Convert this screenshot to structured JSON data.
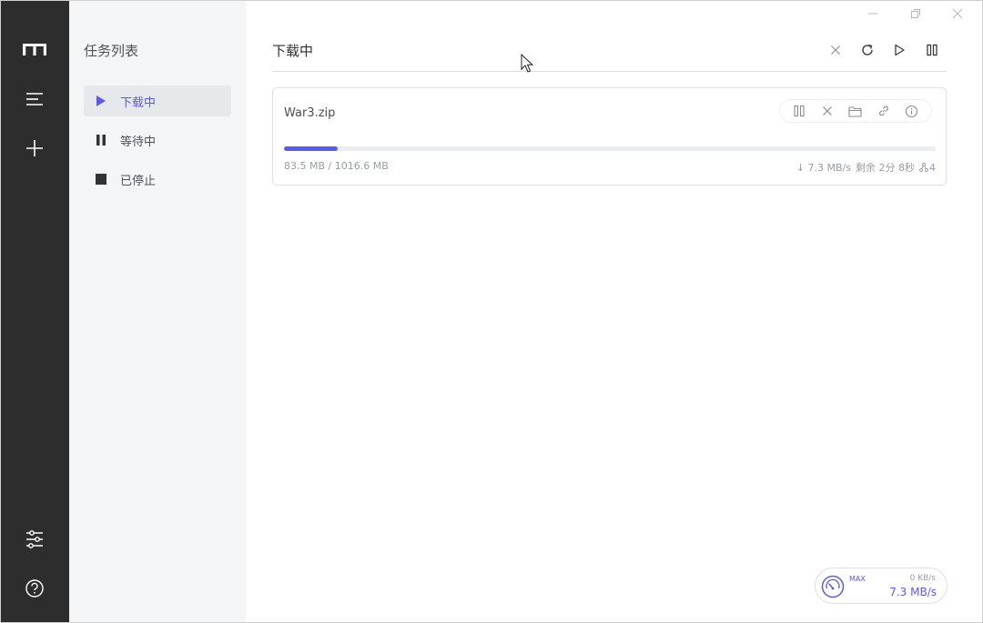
{
  "colors": {
    "accent": "#5b5bea",
    "nav_bg": "#2d2d2d",
    "aside_bg": "#f4f5f7",
    "active_item_bg": "#e7e8ec",
    "border": "#dcdfe6",
    "muted_text": "#9a9ca3"
  },
  "nav": {
    "logo_icon": "app-logo-icon",
    "items": [
      "menu-icon",
      "add-icon"
    ],
    "bottom_items": [
      "preferences-icon",
      "help-icon"
    ]
  },
  "aside": {
    "title": "任务列表",
    "items": [
      {
        "label": "下载中",
        "icon": "play-icon",
        "active": true
      },
      {
        "label": "等待中",
        "icon": "pause-icon",
        "active": false
      },
      {
        "label": "已停止",
        "icon": "stop-icon",
        "active": false
      }
    ]
  },
  "main": {
    "title": "下载中",
    "header_actions": [
      "clear-icon",
      "refresh-icon",
      "resume-all-icon",
      "pause-all-icon"
    ]
  },
  "task": {
    "name": "War3.zip",
    "progress_percent": 8.2,
    "size_text": "83.5 MB / 1016.6 MB",
    "speed_text": "↓ 7.3 MB/s",
    "remaining_text": "剩余 2分 8秒",
    "connections": "4",
    "tools": [
      "pause-icon",
      "delete-icon",
      "folder-icon",
      "link-icon",
      "info-icon"
    ]
  },
  "speedometer": {
    "mode": "MAX",
    "upload": "0 KB/s",
    "download": "7.3 MB/s"
  }
}
